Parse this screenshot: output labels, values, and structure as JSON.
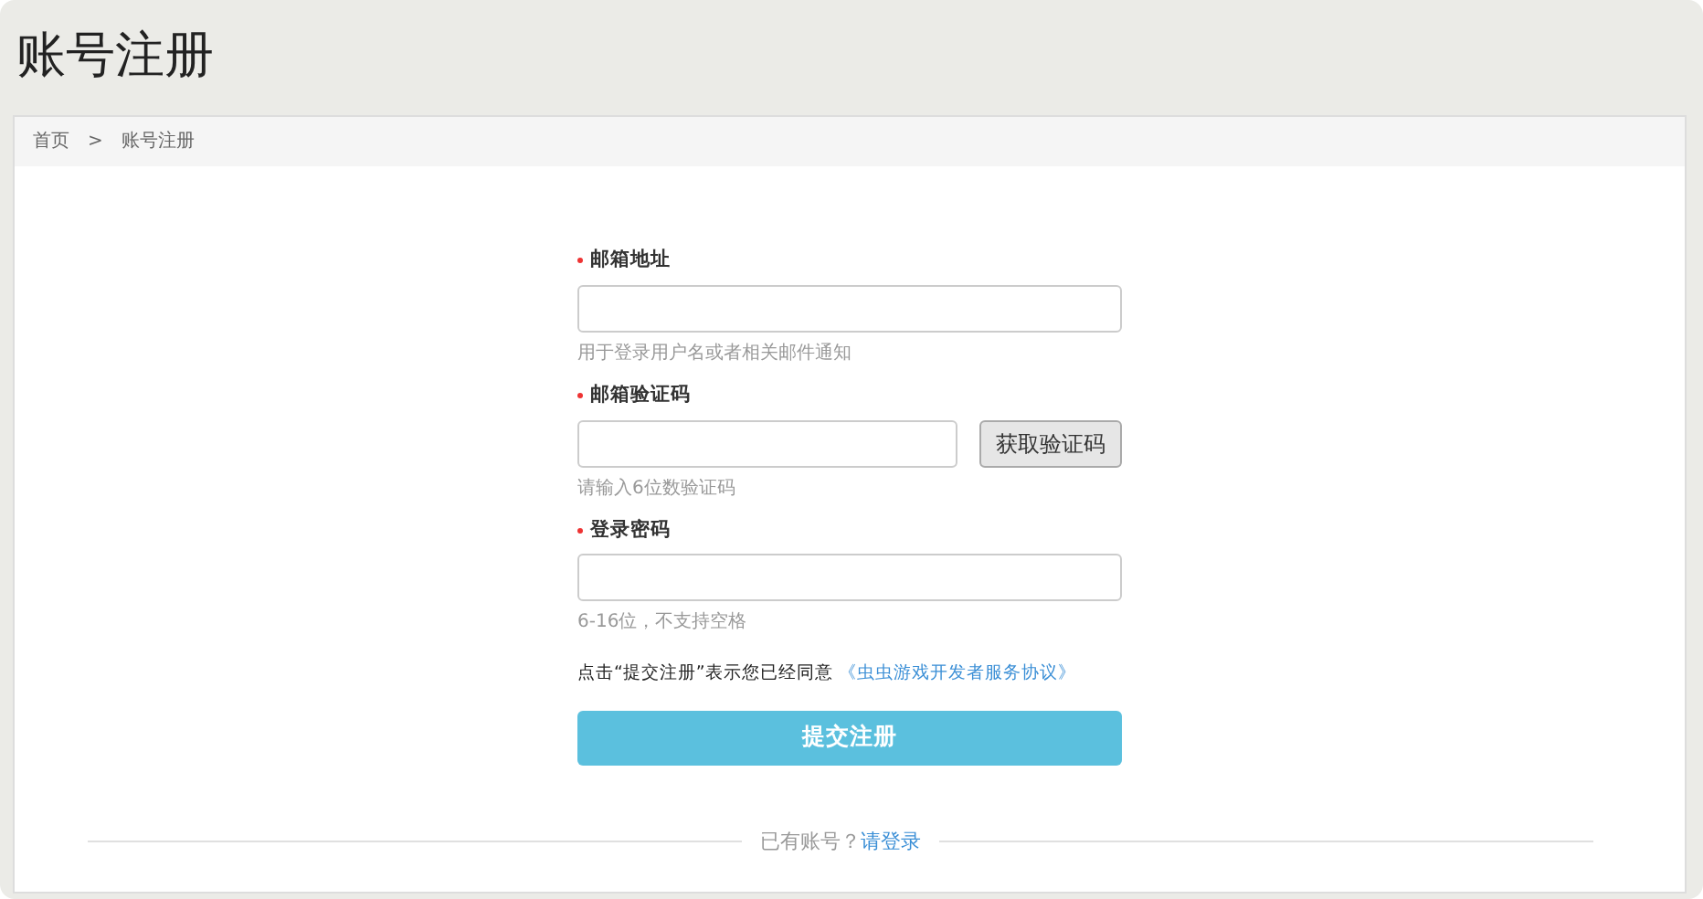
{
  "page_title": "账号注册",
  "breadcrumb": {
    "items": [
      "首页",
      "账号注册"
    ],
    "separator": ">"
  },
  "fields": [
    {
      "label": "邮箱地址",
      "required": true,
      "kind": "text",
      "hint": "用于登录用户名或者相关邮件通知"
    },
    {
      "label": "邮箱验证码",
      "required": true,
      "kind": "code",
      "button": "获取验证码",
      "hint": "请输入6位数验证码"
    },
    {
      "label": "登录密码",
      "required": true,
      "kind": "password",
      "hint": "6-16位，不支持空格"
    }
  ],
  "agreement": {
    "text": "点击“提交注册”表示您已经同意",
    "link": "《虫虫游戏开发者服务协议》"
  },
  "submit": "提交注册",
  "login_prompt": {
    "text": "已有账号？",
    "link": "请登录"
  }
}
